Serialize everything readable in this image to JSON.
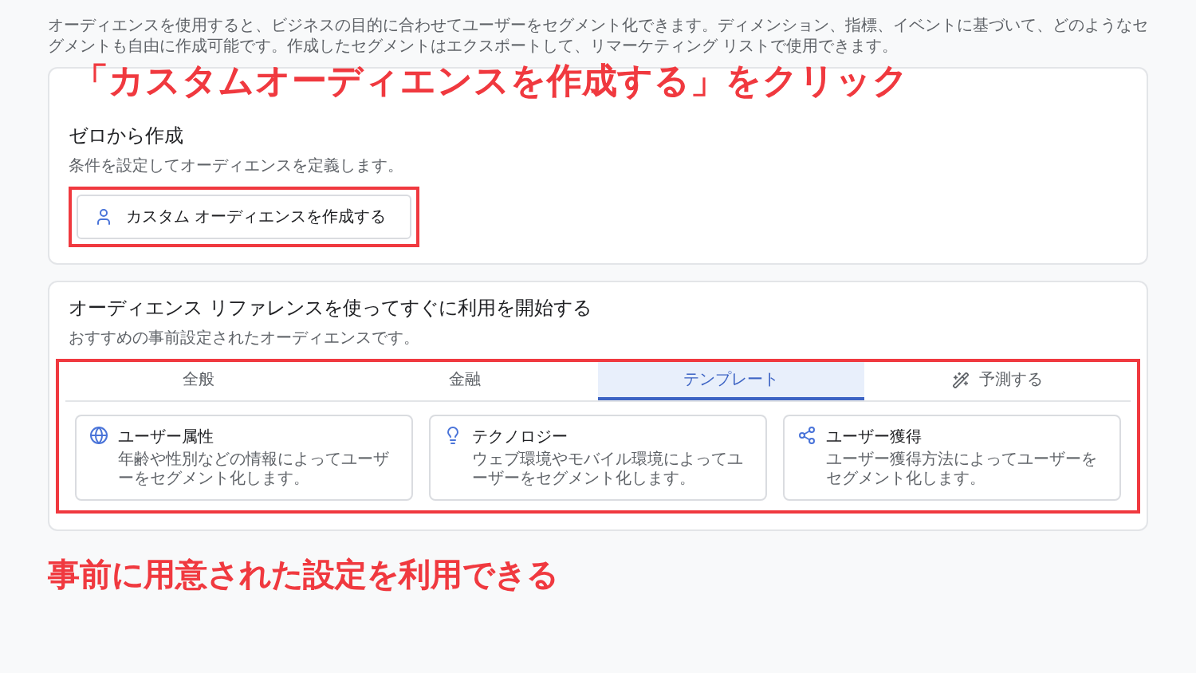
{
  "description": "オーディエンスを使用すると、ビジネスの目的に合わせてユーザーをセグメント化できます。ディメンション、指標、イベントに基づいて、どのようなセグメントも自由に作成可能です。作成したセグメントはエクスポートして、リマーケティング リストで使用できます。",
  "annotations": [
    {
      "text": "「カスタムオーディエンスを作成する」をクリック"
    },
    {
      "text": "事前に用意された設定を利用できる"
    }
  ],
  "scratch_card": {
    "title": "ゼロから作成",
    "subtitle": "条件を設定してオーディエンスを定義します。",
    "button": "カスタム オーディエンスを作成する"
  },
  "reference_card": {
    "title": "オーディエンス リファレンスを使ってすぐに利用を開始する",
    "subtitle": "おすすめの事前設定されたオーディエンスです。",
    "tabs": [
      {
        "label": "全般",
        "selected": false,
        "kind": "plain"
      },
      {
        "label": "金融",
        "selected": false,
        "kind": "plain"
      },
      {
        "label": "テンプレート",
        "selected": true,
        "kind": "plain"
      },
      {
        "label": "予測する",
        "selected": false,
        "kind": "predict"
      }
    ],
    "templates": [
      {
        "kind": "demographics",
        "title": "ユーザー属性",
        "description": "年齢や性別などの情報によってユーザーをセグメント化します。"
      },
      {
        "kind": "technology",
        "title": "テクノロジー",
        "description": "ウェブ環境やモバイル環境によってユーザーをセグメント化します。"
      },
      {
        "kind": "acquisition",
        "title": "ユーザー獲得",
        "description": "ユーザー獲得方法によってユーザーをセグメント化します。"
      }
    ]
  }
}
